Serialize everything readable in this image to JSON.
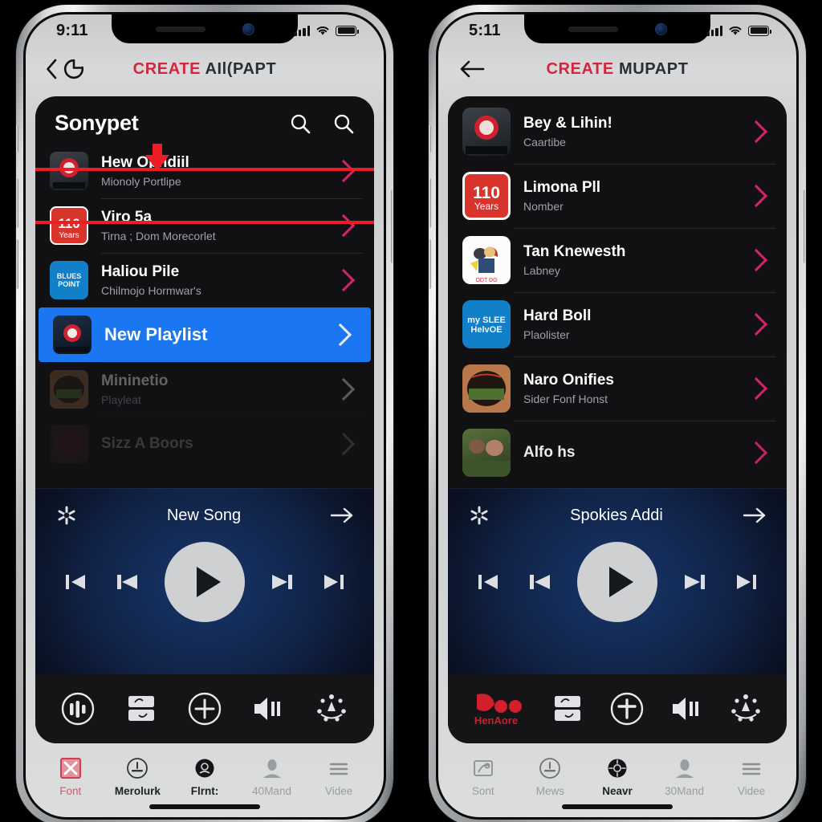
{
  "theme": {
    "accent_red": "#d2263c",
    "annotation_red": "#ee1c25",
    "selection_blue": "#1b76f2",
    "chevron_pink": "#d6246a",
    "card_dark": "#111113"
  },
  "phones": [
    {
      "id": "left",
      "status_bar": {
        "time": "9:11",
        "signal_icon": "cellular-bars-icon",
        "wifi_icon": "wifi-icon",
        "battery_icon": "battery-full-icon"
      },
      "nav": {
        "back_icon": "chevron-left-icon",
        "refresh_icon": "refresh-icon",
        "title_accent": "CREATE",
        "title_rest": "AIl(PAPT"
      },
      "list_header": {
        "title": "Sonypet",
        "search_icon": "search-icon",
        "search_icon_2": "search-icon"
      },
      "rows": [
        {
          "title": "Hew Opndiil",
          "subtitle": "Mionoly Portlipe",
          "art": "poster-dark",
          "chevron": "pink",
          "state": "normal"
        },
        {
          "title": "Viro 5a",
          "subtitle": "Tirna ; Dom Morecorlet",
          "art": "red-110-years",
          "chevron": "pink",
          "state": "normal"
        },
        {
          "title": "Haliou Pile",
          "subtitle": "Chilmojo Hormwar's",
          "art": "blue-text",
          "chevron": "pink",
          "state": "normal"
        },
        {
          "title": "New Playlist",
          "subtitle": "",
          "art": "poster-night",
          "chevron": "white",
          "state": "selected"
        },
        {
          "title": "Mininetio",
          "subtitle": "Playleat",
          "art": "brown-round",
          "chevron": "white",
          "state": "faded"
        },
        {
          "title": "Sizz A Boors",
          "subtitle": "",
          "art": "dark-round",
          "chevron": "dim",
          "state": "faded2"
        }
      ],
      "annotation": {
        "label": "highlight-new-playlist",
        "arrow": "down-arrow"
      },
      "player": {
        "shuffle_icon": "shuffle-asterisk-icon",
        "title": "New Song",
        "forward_icon": "arrow-right-icon",
        "controls": [
          "skip-back-icon",
          "previous-track-icon",
          "play-icon",
          "next-track-icon",
          "skip-forward-icon"
        ]
      },
      "app_toolbar": [
        {
          "icon": "equalizer-circle-icon",
          "style": "outline"
        },
        {
          "icon": "folder-swap-icon",
          "style": "solid"
        },
        {
          "icon": "plus-circle-icon",
          "style": "outline"
        },
        {
          "icon": "volume-icon",
          "style": "solid"
        },
        {
          "icon": "sparkle-burst-icon",
          "style": "solid"
        }
      ],
      "tabs": [
        {
          "label": "Font",
          "icon": "x-square-icon",
          "state": "active-red"
        },
        {
          "label": "Merolurk",
          "icon": "circle-badge-icon",
          "state": "dark"
        },
        {
          "label": "Flrnt:",
          "icon": "filled-circle-face-icon",
          "state": "dark"
        },
        {
          "label": "40Mand",
          "icon": "person-icon",
          "state": "dim"
        },
        {
          "label": "Videe",
          "icon": "hamburger-menu-icon",
          "state": "dim"
        }
      ]
    },
    {
      "id": "right",
      "status_bar": {
        "time": "5:11",
        "signal_icon": "cellular-bars-icon",
        "wifi_icon": "wifi-icon",
        "battery_icon": "battery-full-icon"
      },
      "nav": {
        "back_icon": "arrow-left-icon",
        "refresh_icon": "",
        "title_accent": "CREATE",
        "title_rest": "MUPAPT"
      },
      "list_header": null,
      "rows": [
        {
          "title": "Bey & Lihin!",
          "subtitle": "Caartibe",
          "art": "poster-dark",
          "chevron": "pink",
          "state": "normal"
        },
        {
          "title": "Limona Pll",
          "subtitle": "Nomber",
          "art": "red-110-years",
          "chevron": "pink",
          "state": "normal"
        },
        {
          "title": "Tan Knewesth",
          "subtitle": "Labney",
          "art": "white-cartoon",
          "chevron": "pink",
          "state": "normal"
        },
        {
          "title": "Hard Boll",
          "subtitle": "Plaolister",
          "art": "blue-text",
          "chevron": "pink",
          "state": "normal"
        },
        {
          "title": "Naro Onifies",
          "subtitle": "Sider Fonf Honst",
          "art": "brown-round",
          "chevron": "pink",
          "state": "normal"
        },
        {
          "title": "Alfo hs",
          "subtitle": "",
          "art": "photo-green",
          "chevron": "pink",
          "state": "clipped"
        }
      ],
      "annotation": null,
      "player": {
        "shuffle_icon": "shuffle-asterisk-icon",
        "title": "Spokies Addi",
        "forward_icon": "arrow-right-icon",
        "controls": [
          "skip-back-icon",
          "previous-track-icon",
          "play-icon",
          "next-track-icon",
          "skip-forward-icon"
        ]
      },
      "app_toolbar": [
        {
          "icon": "red-brand-logo-icon",
          "style": "brand",
          "label": "HenAore"
        },
        {
          "icon": "folder-swap-icon",
          "style": "solid"
        },
        {
          "icon": "plus-circle-icon",
          "style": "outline"
        },
        {
          "icon": "volume-icon",
          "style": "solid"
        },
        {
          "icon": "sparkle-burst-icon",
          "style": "solid"
        }
      ],
      "tabs": [
        {
          "label": "Sont",
          "icon": "square-arrow-icon",
          "state": "dim"
        },
        {
          "label": "Mews",
          "icon": "circle-badge-icon",
          "state": "dim"
        },
        {
          "label": "Neavr",
          "icon": "filled-circle-face-icon",
          "state": "dark"
        },
        {
          "label": "30Mand",
          "icon": "person-icon",
          "state": "dim"
        },
        {
          "label": "Videe",
          "icon": "hamburger-menu-icon",
          "state": "dim"
        }
      ]
    }
  ]
}
